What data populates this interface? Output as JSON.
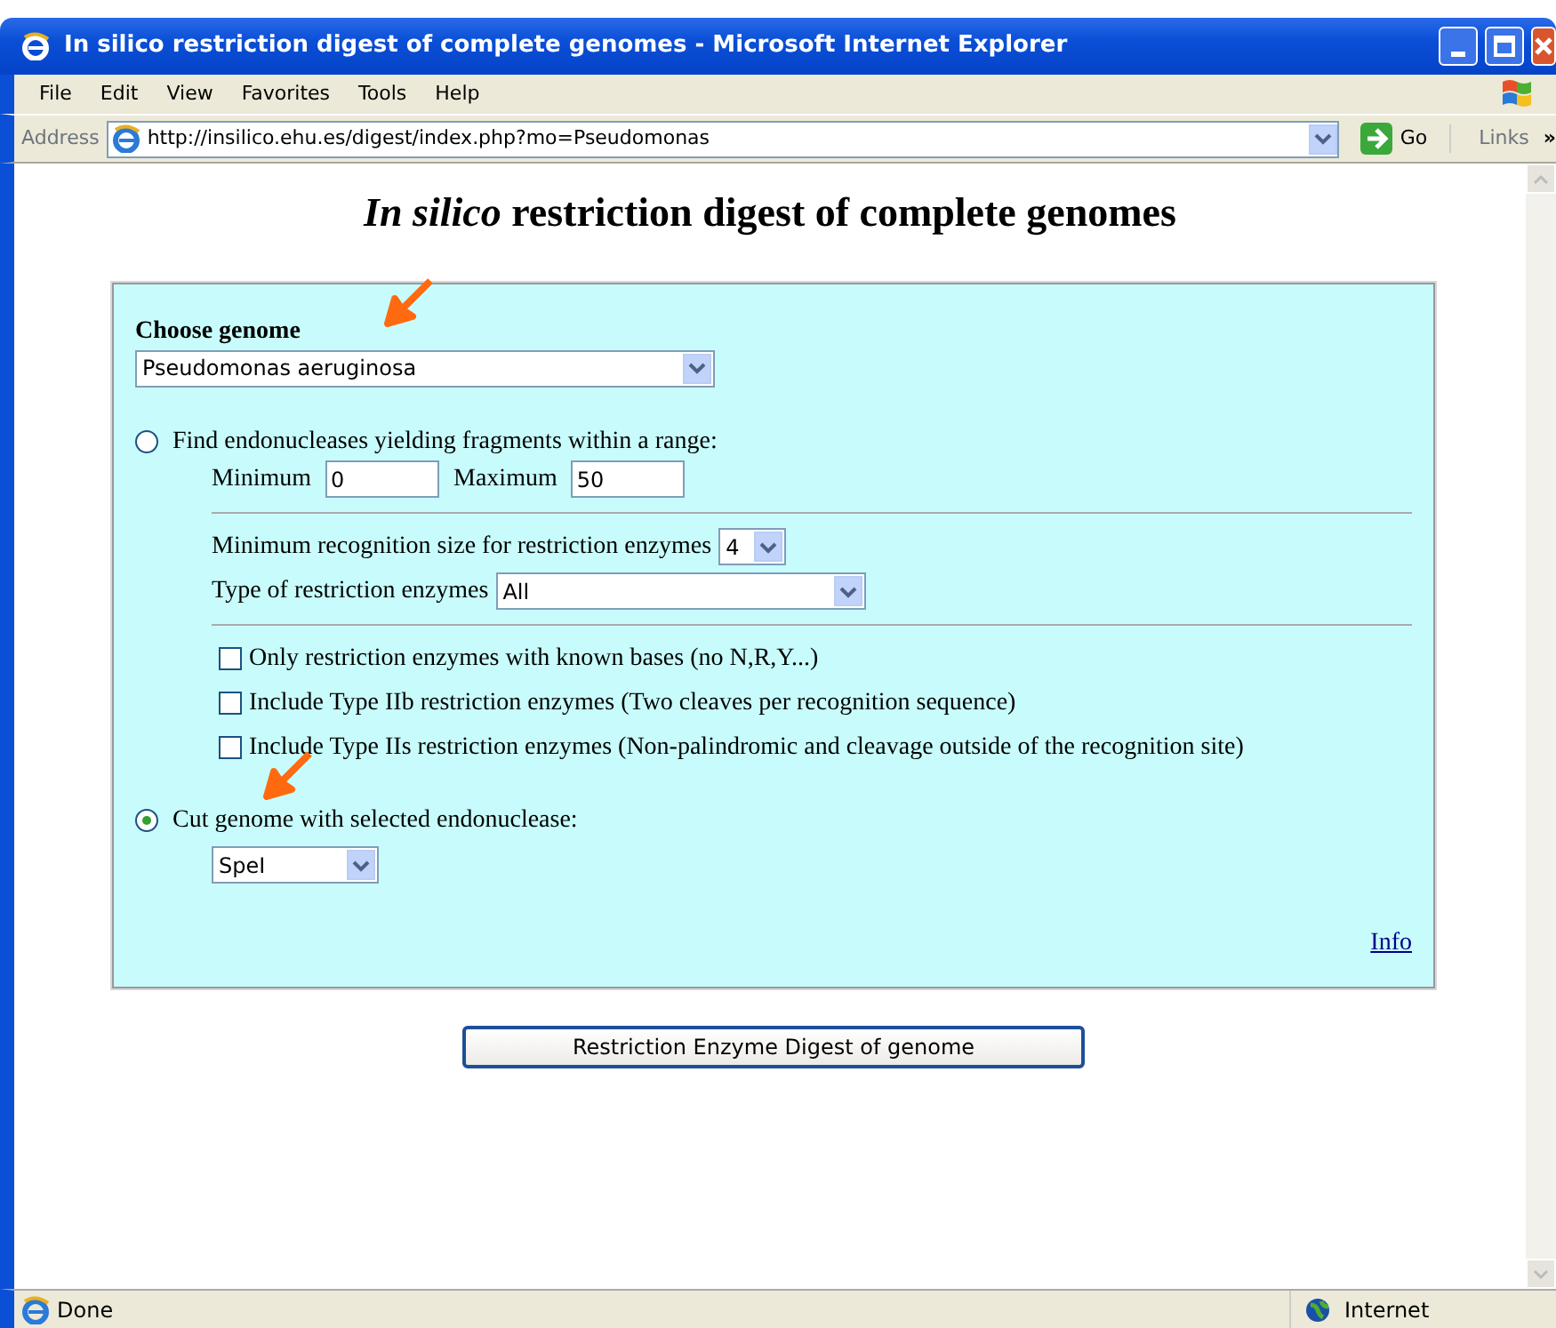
{
  "window": {
    "title": "In silico restriction digest of complete genomes - Microsoft Internet Explorer"
  },
  "menu": [
    "File",
    "Edit",
    "View",
    "Favorites",
    "Tools",
    "Help"
  ],
  "address_bar": {
    "label": "Address",
    "url": "http://insilico.ehu.es/digest/index.php?mo=Pseudomonas",
    "go": "Go",
    "links": "Links",
    "more": "»"
  },
  "page": {
    "heading": "*In silico* restriction digest of complete genomes",
    "genome": {
      "label": "Choose genome",
      "value": "Pseudomonas aeruginosa"
    },
    "modes": [
      {
        "label": "Find endonucleases yielding fragments within a range:",
        "selected": false
      },
      {
        "label": "Cut genome with selected endonuclease:",
        "selected": true
      }
    ],
    "range": {
      "min_label": "Minimum",
      "min": "0",
      "max_label": "Maximum",
      "max": "50"
    },
    "recognition_size": {
      "label": "Minimum recognition size for restriction enzymes",
      "value": "4"
    },
    "enzyme_type": {
      "label": "Type of restriction enzymes",
      "value": "All"
    },
    "options": [
      {
        "label": "Only restriction enzymes with known bases (no N,R,Y...)",
        "checked": false
      },
      {
        "label": "Include Type IIb restriction enzymes (Two cleaves per recognition sequence)",
        "checked": false
      },
      {
        "label": "Include Type IIs restriction enzymes (Non-palindromic and cleavage outside of the recognition site)",
        "checked": false
      }
    ],
    "endonuclease": "SpeI",
    "info_link": "Info",
    "submit": "Restriction Enzyme Digest of genome"
  },
  "status_bar": {
    "text": "Done",
    "zone": "Internet"
  }
}
